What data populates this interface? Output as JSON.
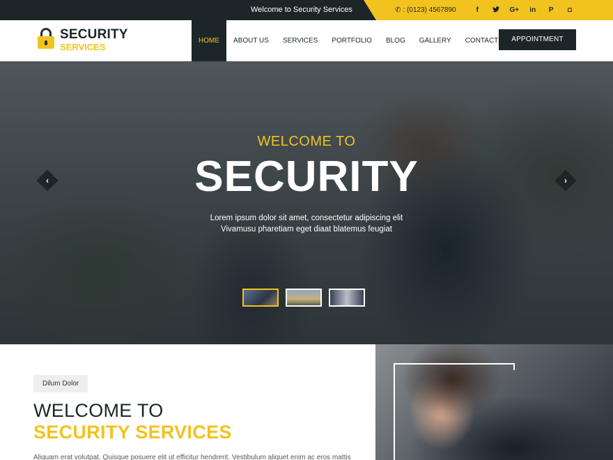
{
  "topbar": {
    "welcome": "Welcome to Security Services",
    "phone": ": (0123) 4567890",
    "phone_icon": "phone-icon",
    "socials": [
      {
        "name": "facebook-icon",
        "glyph": "f"
      },
      {
        "name": "twitter-icon",
        "glyph": "🐦"
      },
      {
        "name": "google-plus-icon",
        "glyph": "G+"
      },
      {
        "name": "linkedin-icon",
        "glyph": "in"
      },
      {
        "name": "pinterest-icon",
        "glyph": "P"
      },
      {
        "name": "instagram-icon",
        "glyph": "◘"
      }
    ]
  },
  "logo": {
    "line1": "SECURITY",
    "line2": "SERVICES",
    "icon": "lock-icon"
  },
  "nav": {
    "items": [
      "HOME",
      "ABOUT US",
      "SERVICES",
      "PORTFOLIO",
      "BLOG",
      "GALLERY",
      "CONTACT US"
    ],
    "active": "HOME",
    "appointment": "APPOINTMENT"
  },
  "hero": {
    "title1": "WELCOME TO",
    "title2": "SECURITY",
    "subtitle": "Lorem ipsum dolor sit amet, consectetur adipiscing elit Vivamusu pharetiam eget diaat blatemus feugiat",
    "prev_icon": "chevron-left-icon",
    "next_icon": "chevron-right-icon",
    "prev_glyph": "‹",
    "next_glyph": "›"
  },
  "about": {
    "tag": "Dilum Dolor",
    "heading1": "WELCOME TO",
    "heading2": "SECURITY SERVICES",
    "paragraph": "Aliquam erat volutpat. Quisque posuere elit ut efficitur hendrerit. Vestibulum aliquet enim ac eros mattis"
  },
  "colors": {
    "dark": "#1c2629",
    "accent": "#f2c31f",
    "white": "#ffffff"
  }
}
